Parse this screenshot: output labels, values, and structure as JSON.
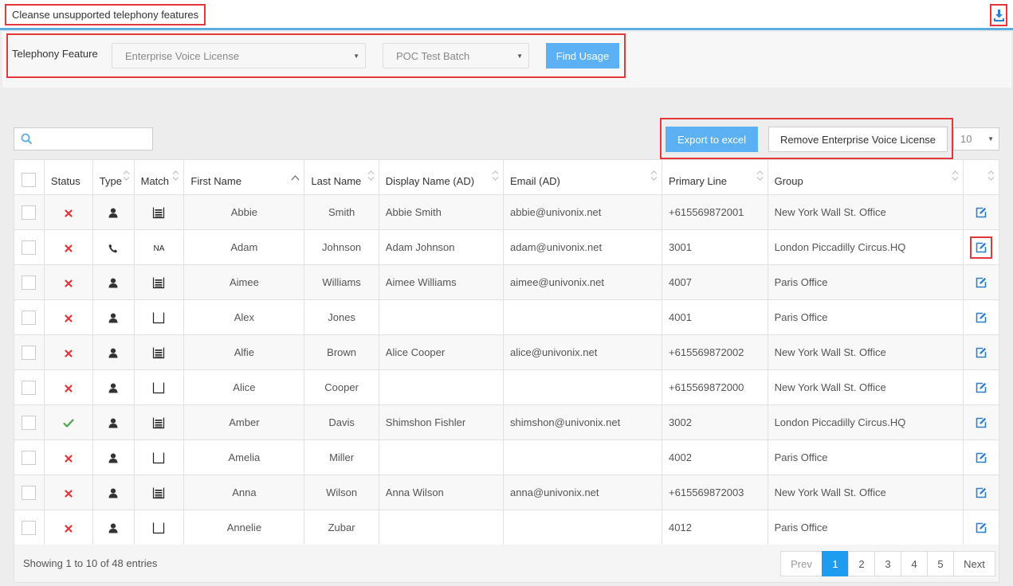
{
  "header": {
    "title": "Cleanse unsupported telephony features"
  },
  "filter": {
    "label": "Telephony Feature",
    "feature_value": "Enterprise Voice License",
    "batch_value": "POC Test Batch",
    "find_label": "Find Usage"
  },
  "toolbar": {
    "search_placeholder": "",
    "export_label": "Export to excel",
    "remove_label": "Remove Enterprise Voice License",
    "page_size": "10"
  },
  "table": {
    "headers": [
      "Status",
      "Type",
      "Match",
      "First Name",
      "Last Name",
      "Display Name (AD)",
      "Email (AD)",
      "Primary Line",
      "Group"
    ],
    "rows": [
      {
        "status": "x",
        "type": "user",
        "match": "full",
        "first": "Abbie",
        "last": "Smith",
        "display": "Abbie Smith",
        "email": "abbie@univonix.net",
        "line": "+615569872001",
        "group": "New York Wall St. Office"
      },
      {
        "status": "x",
        "type": "phone",
        "match": "NA",
        "first": "Adam",
        "last": "Johnson",
        "display": "Adam Johnson",
        "email": "adam@univonix.net",
        "line": "3001",
        "group": "London Piccadilly Circus.HQ"
      },
      {
        "status": "x",
        "type": "user",
        "match": "full",
        "first": "Aimee",
        "last": "Williams",
        "display": "Aimee Williams",
        "email": "aimee@univonix.net",
        "line": "4007",
        "group": "Paris Office"
      },
      {
        "status": "x",
        "type": "user",
        "match": "empty",
        "first": "Alex",
        "last": "Jones",
        "display": "",
        "email": "",
        "line": "4001",
        "group": "Paris Office"
      },
      {
        "status": "x",
        "type": "user",
        "match": "full",
        "first": "Alfie",
        "last": "Brown",
        "display": "Alice Cooper",
        "email": "alice@univonix.net",
        "line": "+615569872002",
        "group": "New York Wall St. Office"
      },
      {
        "status": "x",
        "type": "user",
        "match": "empty",
        "first": "Alice",
        "last": "Cooper",
        "display": "",
        "email": "",
        "line": "+615569872000",
        "group": "New York Wall St. Office"
      },
      {
        "status": "check",
        "type": "user",
        "match": "full",
        "first": "Amber",
        "last": "Davis",
        "display": "Shimshon Fishler",
        "email": "shimshon@univonix.net",
        "line": "3002",
        "group": "London Piccadilly Circus.HQ"
      },
      {
        "status": "x",
        "type": "user",
        "match": "empty",
        "first": "Amelia",
        "last": "Miller",
        "display": "",
        "email": "",
        "line": "4002",
        "group": "Paris Office"
      },
      {
        "status": "x",
        "type": "user",
        "match": "full",
        "first": "Anna",
        "last": "Wilson",
        "display": "Anna Wilson",
        "email": "anna@univonix.net",
        "line": "+615569872003",
        "group": "New York Wall St. Office"
      },
      {
        "status": "x",
        "type": "user",
        "match": "empty",
        "first": "Annelie",
        "last": "Zubar",
        "display": "",
        "email": "",
        "line": "4012",
        "group": "Paris Office"
      }
    ]
  },
  "footer": {
    "info": "Showing 1 to 10 of 48 entries",
    "prev": "Prev",
    "next": "Next",
    "pages": [
      "1",
      "2",
      "3",
      "4",
      "5"
    ],
    "current_page": "1"
  },
  "colors": {
    "accent": "#1e9cf0",
    "button": "#5bb1f3",
    "highlight": "#e4383d",
    "x": "#e0363b",
    "check": "#4aa84a",
    "edit": "#2f7fd0"
  }
}
